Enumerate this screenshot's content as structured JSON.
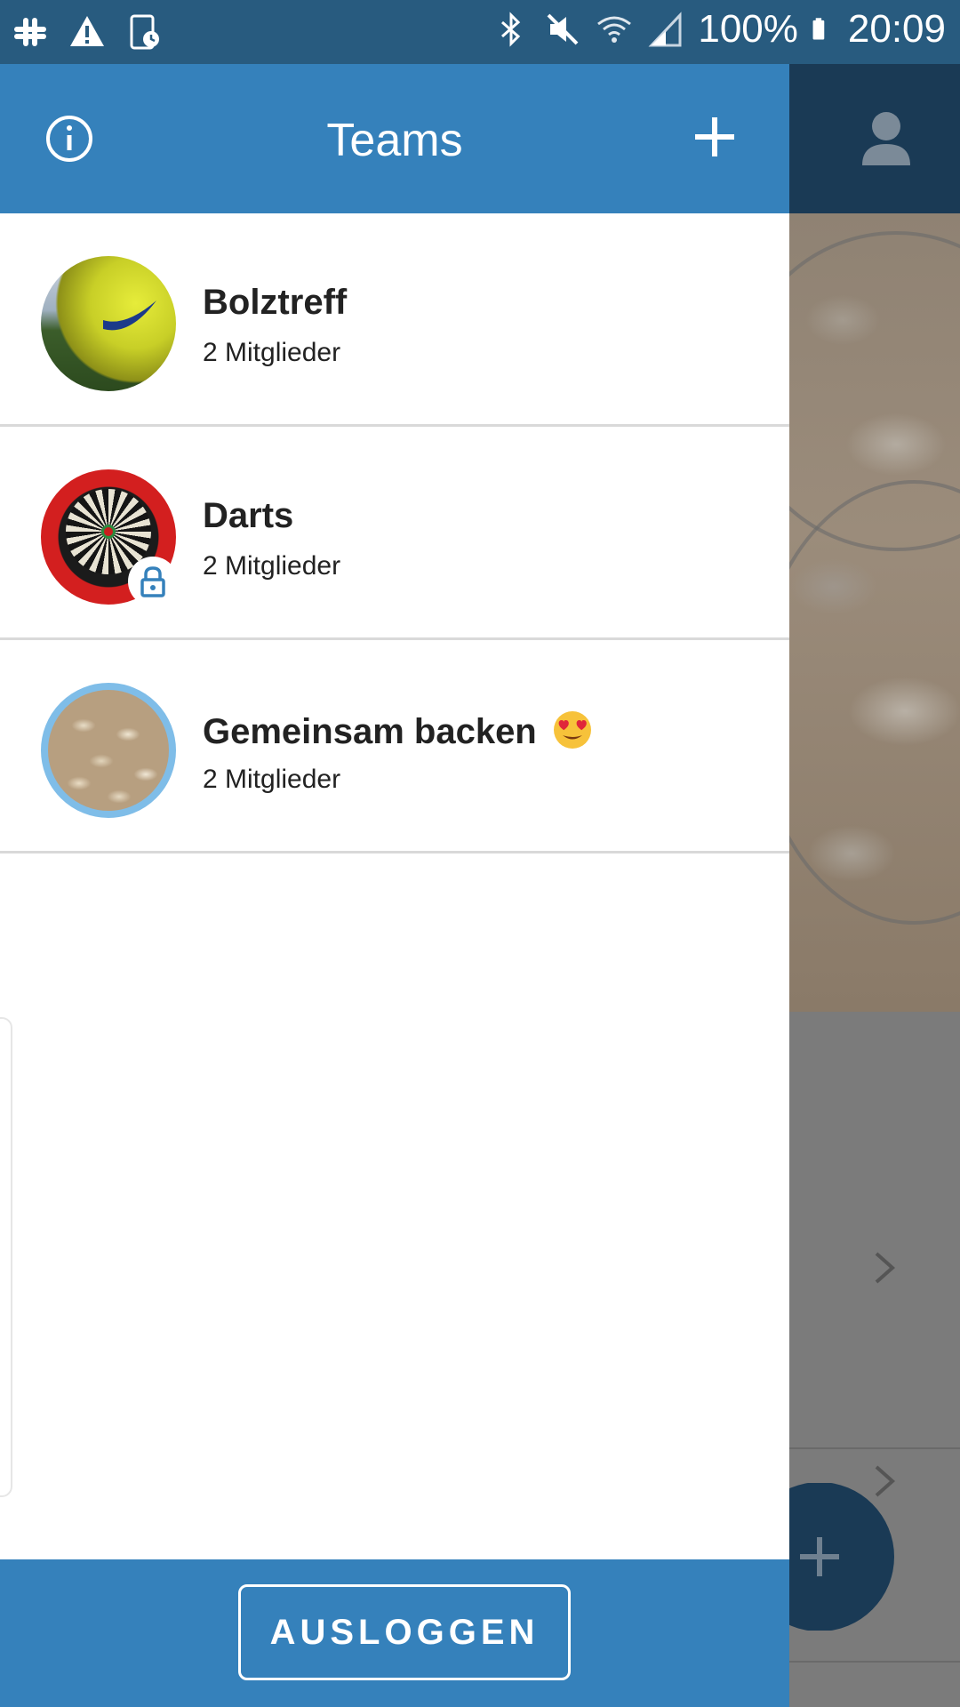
{
  "status_bar": {
    "battery": "100%",
    "time": "20:09",
    "icons_left": [
      "slack-icon",
      "warning-icon",
      "device-icon"
    ],
    "icons_right": [
      "bluetooth-icon",
      "mute-icon",
      "wifi-icon",
      "signal-icon",
      "battery-icon"
    ]
  },
  "drawer": {
    "title": "Teams",
    "info_icon": "info-icon",
    "add_icon": "plus-icon",
    "teams": [
      {
        "name": "Bolztreff",
        "members": "2 Mitglieder",
        "locked": false
      },
      {
        "name": "Darts",
        "members": "2 Mitglieder",
        "locked": true
      },
      {
        "name": "Gemeinsam backen",
        "members": "2 Mitglieder",
        "locked": false,
        "emoji": "heart-eyes-emoji"
      }
    ],
    "logout_label": "AUSLOGGEN"
  },
  "colors": {
    "header_blue": "#3581bb",
    "status_bar": "#285b7f",
    "background_header": "#1a3a55"
  }
}
